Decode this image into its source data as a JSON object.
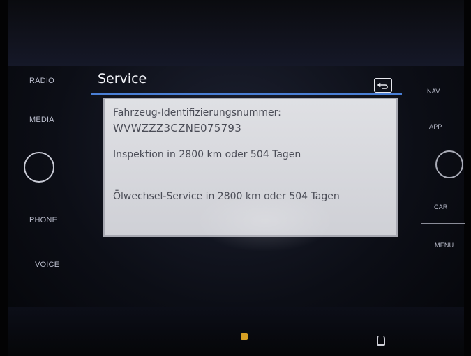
{
  "left_buttons": {
    "radio": "RADIO",
    "media": "MEDIA",
    "phone": "PHONE",
    "voice": "VOICE"
  },
  "right_buttons": {
    "nav": "NAV",
    "app": "APP",
    "car": "CAR",
    "menu": "MENU"
  },
  "screen": {
    "title": "Service",
    "back_icon": "back-arrow-icon",
    "accent_color": "#4a7fd6",
    "panel_background": "#dcdde2",
    "text_color": "#4a4c56"
  },
  "service_info": {
    "vin_label": "Fahrzeug-Identifizierungsnummer:",
    "vin_value": "WVWZZZ3CZNE075793",
    "inspection": "Inspektion in 2800 km oder 504 Tagen",
    "oil_change": "Ölwechsel-Service in 2800 km oder 504 Tagen"
  }
}
